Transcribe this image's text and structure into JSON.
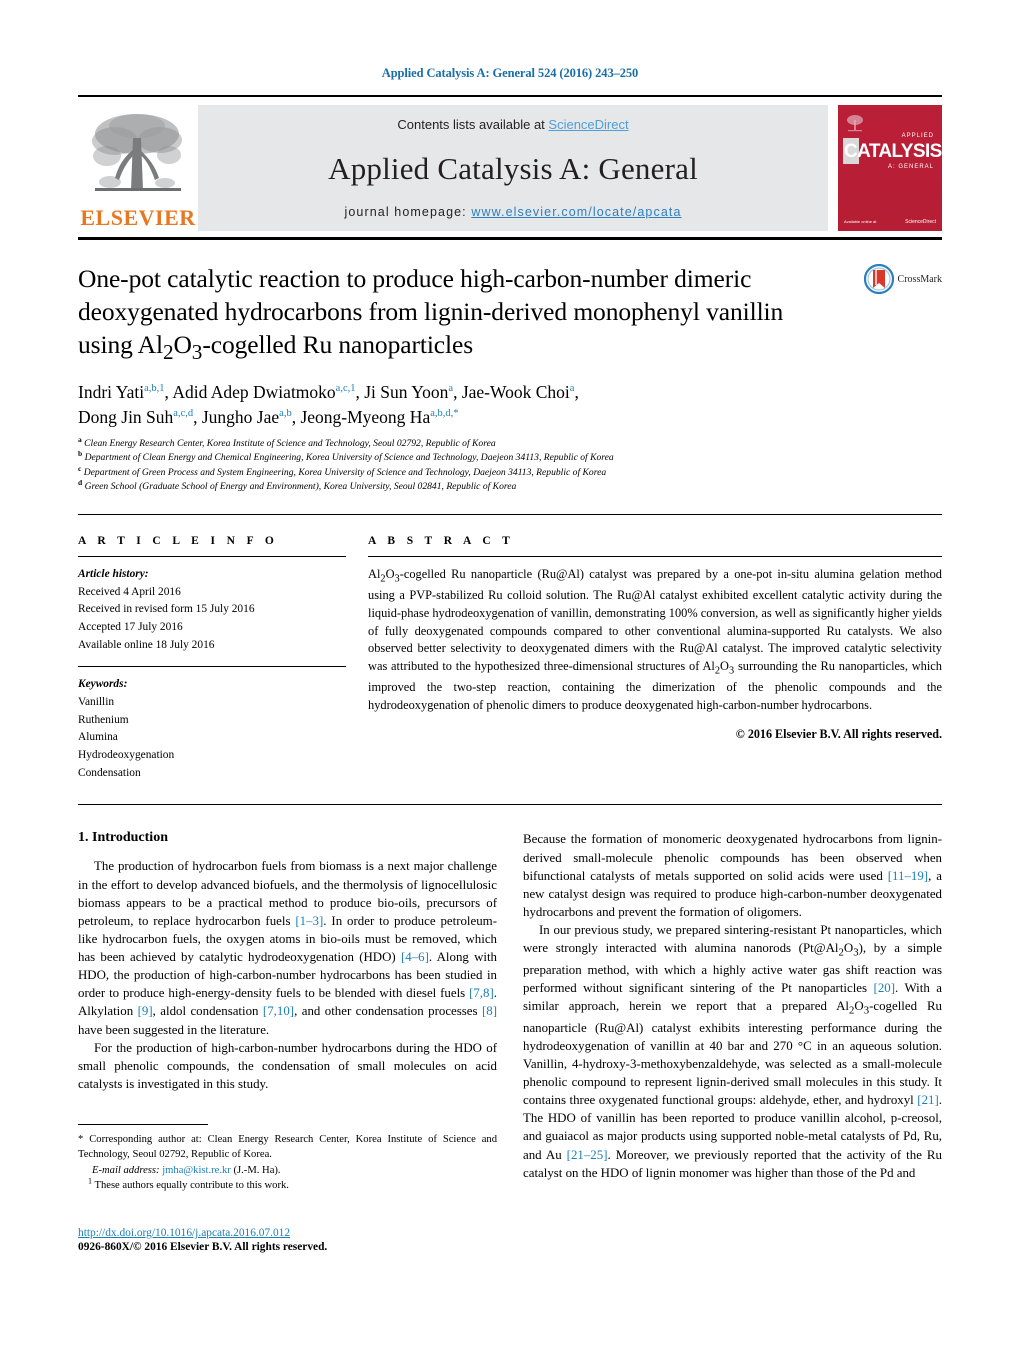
{
  "running_head": "Applied Catalysis A: General 524 (2016) 243–250",
  "masthead": {
    "publisher_name": "ELSEVIER",
    "contents_prefix": "Contents lists available at ",
    "contents_link": "ScienceDirect",
    "journal_title": "Applied Catalysis A: General",
    "homepage_prefix": "journal homepage: ",
    "homepage_url": "www.elsevier.com/locate/apcata",
    "cover": {
      "title": "CATALYSIS",
      "sub_top": "APPLIED",
      "sub_bottom": "A: GENERAL",
      "footer_left": "Available online at",
      "footer_right": "ScienceDirect"
    }
  },
  "crossmark": {
    "label": "CrossMark"
  },
  "article": {
    "title": "One-pot catalytic reaction to produce high-carbon-number dimeric deoxygenated hydrocarbons from lignin-derived monophenyl vanillin using Al₂O₃-cogelled Ru nanoparticles",
    "authors_line_1": "Indri Yati",
    "authors": [
      {
        "name": "Indri Yati",
        "marks": "a,b,1"
      },
      {
        "name": "Adid Adep Dwiatmoko",
        "marks": "a,c,1"
      },
      {
        "name": "Ji Sun Yoon",
        "marks": "a"
      },
      {
        "name": "Jae-Wook Choi",
        "marks": "a"
      },
      {
        "name": "Dong Jin Suh",
        "marks": "a,c,d"
      },
      {
        "name": "Jungho Jae",
        "marks": "a,b"
      },
      {
        "name": "Jeong-Myeong Ha",
        "marks": "a,b,d,*"
      }
    ],
    "affiliations": [
      {
        "mark": "a",
        "text": "Clean Energy Research Center, Korea Institute of Science and Technology, Seoul 02792, Republic of Korea"
      },
      {
        "mark": "b",
        "text": "Department of Clean Energy and Chemical Engineering, Korea University of Science and Technology, Daejeon 34113, Republic of Korea"
      },
      {
        "mark": "c",
        "text": "Department of Green Process and System Engineering, Korea University of Science and Technology, Daejeon 34113, Republic of Korea"
      },
      {
        "mark": "d",
        "text": "Green School (Graduate School of Energy and Environment), Korea University, Seoul 02841, Republic of Korea"
      }
    ]
  },
  "article_info": {
    "label": "A R T I C L E   I N F O",
    "history_head": "Article history:",
    "history": [
      "Received 4 April 2016",
      "Received in revised form 15 July 2016",
      "Accepted 17 July 2016",
      "Available online 18 July 2016"
    ],
    "keywords_head": "Keywords:",
    "keywords": [
      "Vanillin",
      "Ruthenium",
      "Alumina",
      "Hydrodeoxygenation",
      "Condensation"
    ]
  },
  "abstract": {
    "label": "A B S T R A C T",
    "text": "Al₂O₃-cogelled Ru nanoparticle (Ru@Al) catalyst was prepared by a one-pot in-situ alumina gelation method using a PVP-stabilized Ru colloid solution. The Ru@Al catalyst exhibited excellent catalytic activity during the liquid-phase hydrodeoxygenation of vanillin, demonstrating 100% conversion, as well as significantly higher yields of fully deoxygenated compounds compared to other conventional alumina-supported Ru catalysts. We also observed better selectivity to deoxygenated dimers with the Ru@Al catalyst. The improved catalytic selectivity was attributed to the hypothesized three-dimensional structures of Al₂O₃ surrounding the Ru nanoparticles, which improved the two-step reaction, containing the dimerization of the phenolic compounds and the hydrodeoxygenation of phenolic dimers to produce deoxygenated high-carbon-number hydrocarbons.",
    "copyright": "© 2016 Elsevier B.V. All rights reserved."
  },
  "introduction": {
    "heading": "1.  Introduction",
    "left_paragraphs": [
      "The production of hydrocarbon fuels from biomass is a next major challenge in the effort to develop advanced biofuels, and the thermolysis of lignocellulosic biomass appears to be a practical method to produce bio-oils, precursors of petroleum, to replace hydrocarbon fuels [1–3]. In order to produce petroleum-like hydrocarbon fuels, the oxygen atoms in bio-oils must be removed, which has been achieved by catalytic hydrodeoxygenation (HDO) [4–6]. Along with HDO, the production of high-carbon-number hydrocarbons has been studied in order to produce high-energy-density fuels to be blended with diesel fuels [7,8]. Alkylation [9], aldol condensation [7,10], and other condensation processes [8] have been suggested in the literature.",
      "For the production of high-carbon-number hydrocarbons during the HDO of small phenolic compounds, the condensation of small molecules on acid catalysts is investigated in this study."
    ],
    "right_paragraphs": [
      "Because the formation of monomeric deoxygenated hydrocarbons from lignin-derived small-molecule phenolic compounds has been observed when bifunctional catalysts of metals supported on solid acids were used [11–19], a new catalyst design was required to produce high-carbon-number deoxygenated hydrocarbons and prevent the formation of oligomers.",
      "In our previous study, we prepared sintering-resistant Pt nanoparticles, which were strongly interacted with alumina nanorods (Pt@Al₂O₃), by a simple preparation method, with which a highly active water gas shift reaction was performed without significant sintering of the Pt nanoparticles [20]. With a similar approach, herein we report that a prepared Al₂O₃-cogelled Ru nanoparticle (Ru@Al) catalyst exhibits interesting performance during the hydrodeoxygenation of vanillin at 40 bar and 270 °C in an aqueous solution. Vanillin, 4-hydroxy-3-methoxybenzaldehyde, was selected as a small-molecule phenolic compound to represent lignin-derived small molecules in this study. It contains three oxygenated functional groups: aldehyde, ether, and hydroxyl [21]. The HDO of vanillin has been reported to produce vanillin alcohol, p-creosol, and guaiacol as major products using supported noble-metal catalysts of Pd, Ru, and Au [21–25]. Moreover, we previously reported that the activity of the Ru catalyst on the HDO of lignin monomer was higher than those of the Pd and"
    ]
  },
  "footnotes": {
    "corresponding": "* Corresponding author at: Clean Energy Research Center, Korea Institute of Science and Technology, Seoul 02792, Republic of Korea.",
    "email_label": "E-mail address:",
    "email": "jmha@kist.re.kr",
    "email_suffix": "(J.-M. Ha).",
    "equal_contrib": "These authors equally contribute to this work.",
    "equal_contrib_mark": "1"
  },
  "footer": {
    "doi": "http://dx.doi.org/10.1016/j.apcata.2016.07.012",
    "issn": "0926-860X/© 2016 Elsevier B.V. All rights reserved."
  },
  "colors": {
    "link_blue": "#1a7fb5",
    "sciencedirect_blue": "#4f9ed9",
    "elsevier_orange": "#E87722",
    "cover_red": "#b8223c",
    "band_gray": "#e6e7e8"
  }
}
